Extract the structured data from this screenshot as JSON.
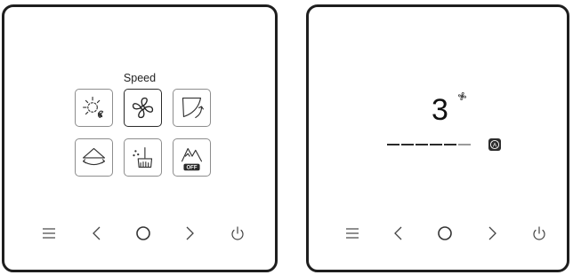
{
  "left_panel": {
    "title": "Speed",
    "tiles": [
      {
        "name": "light-fan-icon",
        "selected": false
      },
      {
        "name": "fan-icon",
        "selected": true
      },
      {
        "name": "swing-arc-icon",
        "selected": false
      },
      {
        "name": "dome-swing-icon",
        "selected": false
      },
      {
        "name": "clean-brush-icon",
        "selected": false
      },
      {
        "name": "mountain-off-icon",
        "selected": false,
        "badge": "OFF"
      }
    ]
  },
  "right_panel": {
    "speed_value": "3",
    "speed_level": 5,
    "speed_max": 6,
    "mode_badge": "A"
  },
  "nav_icons": [
    "menu-icon",
    "chevron-left-icon",
    "circle-icon",
    "chevron-right-icon",
    "power-icon"
  ],
  "colors": {
    "border": "#1e1e1e",
    "icon": "#333333",
    "segment_on": "#2a2a2a",
    "segment_off": "#9a9a9a"
  }
}
